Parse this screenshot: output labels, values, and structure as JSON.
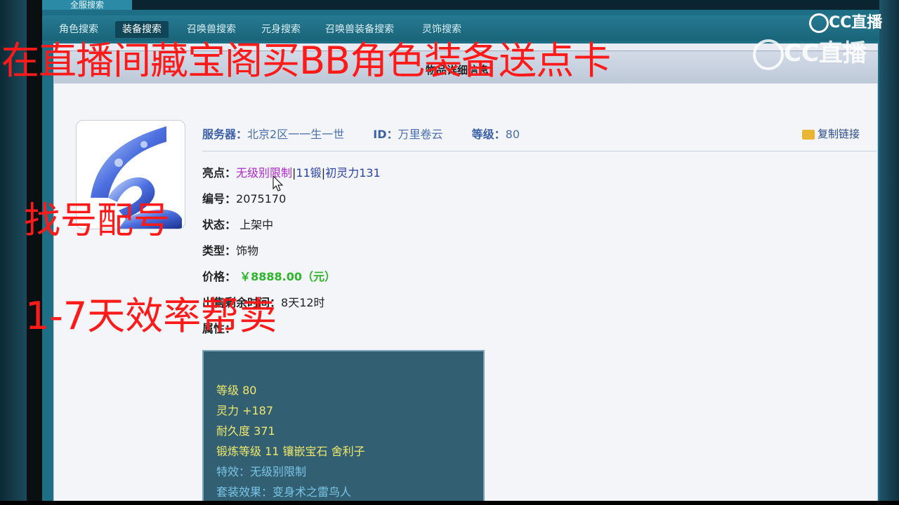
{
  "app": {
    "top_tab": "全服搜索",
    "nav": [
      "角色搜索",
      "装备搜索",
      "召唤兽搜索",
      "元身搜索",
      "召唤兽装备搜索",
      "灵饰搜索"
    ],
    "active_nav_index": 1
  },
  "panel": {
    "title": "物品详细信息",
    "copy_link": "复制链接",
    "server_label": "服务器：",
    "server_value": "北京2区一一生一世",
    "id_label": "ID：",
    "id_value": "万里卷云",
    "level_label": "等级：",
    "level_value": "80",
    "highlight_label": "亮点：",
    "highlights": [
      "无级别限制",
      "11锻",
      "初灵力131"
    ],
    "highlight_sep": "|",
    "serial_label": "编号：",
    "serial_value": "2075170",
    "status_label": "状态：",
    "status_value": "上架中",
    "type_label": "类型：",
    "type_value": "饰物",
    "price_label": "价格：",
    "price_value": "￥8888.00（元）",
    "remain_label": "出售剩余时间：",
    "remain_value": "8天12时",
    "attr_label": "属性："
  },
  "attributes": [
    {
      "text": "等级 80",
      "color": "yellow"
    },
    {
      "text": "灵力 +187",
      "color": "yellow"
    },
    {
      "text": "耐久度 371",
      "color": "yellow"
    },
    {
      "text": "锻炼等级 11 镶嵌宝石 舍利子",
      "color": "yellow"
    },
    {
      "text": "特效：无级别限制",
      "color": "cyan"
    },
    {
      "text": "套装效果：变身术之雷鸟人",
      "color": "cyan"
    }
  ],
  "overlay": {
    "banner": "在直播间藏宝阁买BB角色装备送点卡",
    "line2": "找号配号",
    "line3": "1-7天效率帮卖"
  },
  "watermark": {
    "text": "CC直播"
  },
  "colors": {
    "app_bg": "#1e6f85",
    "overlay_red": "#ff1a1a",
    "price_green": "#2fb52a",
    "attr_yellow": "#f0e86a",
    "attr_cyan": "#79c5e6"
  }
}
